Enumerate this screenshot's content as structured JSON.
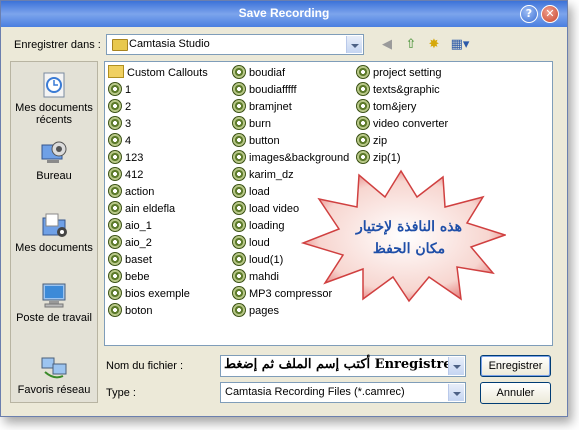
{
  "window": {
    "title": "Save Recording"
  },
  "lookin": {
    "label": "Enregistrer dans :",
    "value": "Camtasia Studio"
  },
  "toolbar": {
    "back_icon": "back-arrow-icon",
    "up_icon": "up-folder-icon",
    "newfolder_icon": "new-folder-icon",
    "views_icon": "views-menu-icon"
  },
  "places": [
    {
      "label": "Mes documents récents",
      "icon": "recent-documents-icon"
    },
    {
      "label": "Bureau",
      "icon": "desktop-icon"
    },
    {
      "label": "Mes documents",
      "icon": "my-documents-icon"
    },
    {
      "label": "Poste de travail",
      "icon": "my-computer-icon"
    },
    {
      "label": "Favoris réseau",
      "icon": "network-places-icon"
    }
  ],
  "files": {
    "col1": [
      "Custom Callouts",
      "1",
      "2",
      "3",
      "4",
      "123",
      "412",
      "action",
      "ain eldefla",
      "aio_1",
      "aio_2",
      "baset",
      "bebe",
      "bios exemple",
      "boton"
    ],
    "col2": [
      "boudiaf",
      "boudiafffff",
      "bramjnet",
      "burn",
      "button",
      "images&background",
      "karim_dz",
      "load",
      "load video",
      "loading",
      "loud",
      "loud(1)",
      "mahdi",
      "MP3 compressor",
      "pages"
    ],
    "col3": [
      "project setting",
      "texts&graphic",
      "tom&jery",
      "video converter",
      "zip",
      "zip(1)"
    ]
  },
  "filename": {
    "label": "Nom du fichier :",
    "value": "أكتب إسم الملف ثم إضغط Enregistrer"
  },
  "filetype": {
    "label": "Type :",
    "value": "Camtasia Recording Files (*.camrec)"
  },
  "buttons": {
    "save": "Enregistrer",
    "cancel": "Annuler"
  },
  "annotation": {
    "line1": "هذه النافذة لإختيار",
    "line2": "مكان الحفظ"
  }
}
